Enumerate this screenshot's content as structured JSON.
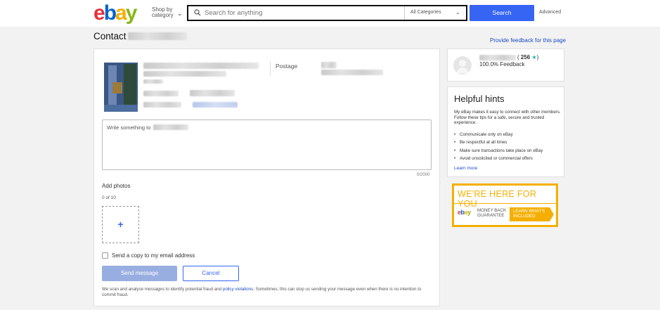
{
  "header": {
    "logo_letters": [
      "e",
      "b",
      "a",
      "y"
    ],
    "logo_colors": [
      "#e53238",
      "#0064d2",
      "#f5af02",
      "#86b817"
    ],
    "shop_by_label": "Shop by category",
    "search_placeholder": "Search for anything",
    "category_select": "All Categories",
    "search_button": "Search",
    "advanced_link": "Advanced"
  },
  "page": {
    "title": "Contact",
    "feedback_link": "Provide feedback for this page"
  },
  "item": {
    "postage_label": "Postage"
  },
  "message": {
    "placeholder": "Write something to",
    "char_count": "0/2000"
  },
  "photos": {
    "label": "Add photos",
    "count": "0 of 10",
    "add_symbol": "+"
  },
  "copy_option": {
    "label": "Send a copy to my email address",
    "checked": false
  },
  "actions": {
    "send": "Send message",
    "cancel": "Cancel"
  },
  "disclaimer": {
    "before": "We scan and analyse messages to identify potential fraud and ",
    "link": "policy violations",
    "after": ". Sometimes, this can stop us sending your message even when there is no intention to commit fraud."
  },
  "seller": {
    "score": "256",
    "score_open": "( ",
    "score_close": ")",
    "star": "★",
    "feedback": "100.0% Feedback"
  },
  "hints": {
    "title": "Helpful hints",
    "text": "My eBay makes it easy to connect with other members. Follow these tips for a safe, secure and trusted experience.",
    "items": [
      "Communicate only on eBay",
      "Be respectful at all times",
      "Make sure transactions take place on eBay",
      "Avoid unsolicited or commercial offers"
    ],
    "learn_more": "Learn more"
  },
  "promo": {
    "title": "WE'RE HERE FOR YOU",
    "mbg": "MONEY BACK GUARANTEE",
    "cta": "LEARN WHAT'S INCLUDED",
    "accent": "#f5af02"
  }
}
